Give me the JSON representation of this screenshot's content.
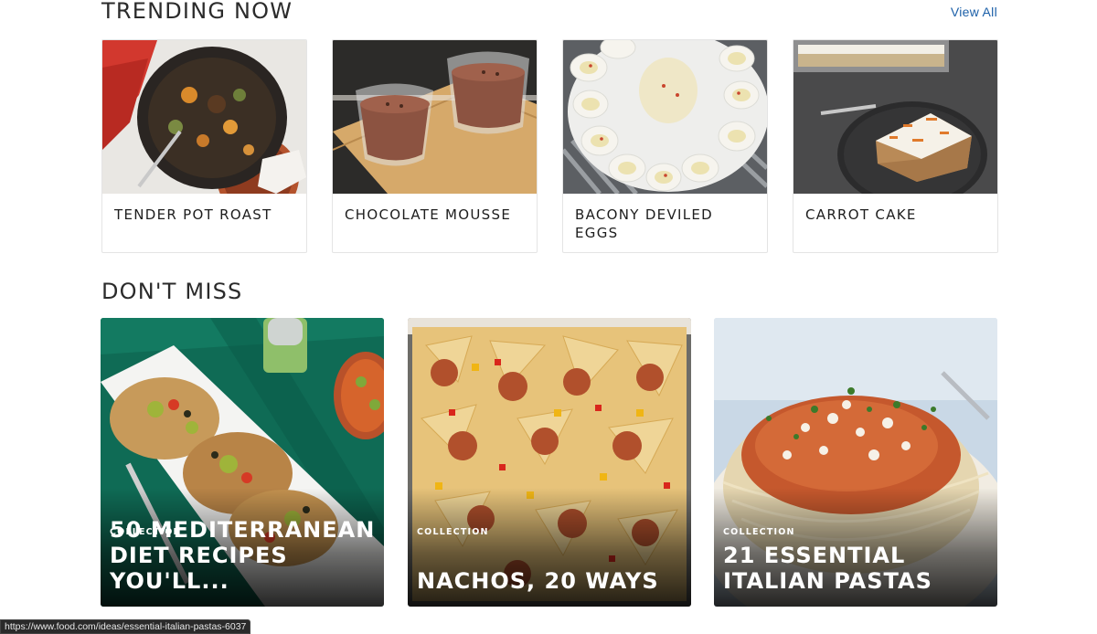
{
  "trending": {
    "title": "TRENDING NOW",
    "view_all": "View All",
    "cards": [
      {
        "title": "TENDER POT ROAST"
      },
      {
        "title": "CHOCOLATE MOUSSE"
      },
      {
        "title": "BACONY DEVILED EGGS"
      },
      {
        "title": "CARROT CAKE"
      }
    ]
  },
  "dont_miss": {
    "title": "DON'T MISS",
    "cards": [
      {
        "kicker": "COLLECTION",
        "title": "50 MEDITERRANEAN DIET RECIPES YOU'LL..."
      },
      {
        "kicker": "COLLECTION",
        "title": "NACHOS, 20 WAYS"
      },
      {
        "kicker": "COLLECTION",
        "title": "21 ESSENTIAL ITALIAN PASTAS"
      }
    ]
  },
  "status_bar": {
    "url": "https://www.food.com/ideas/essential-italian-pastas-6037"
  }
}
